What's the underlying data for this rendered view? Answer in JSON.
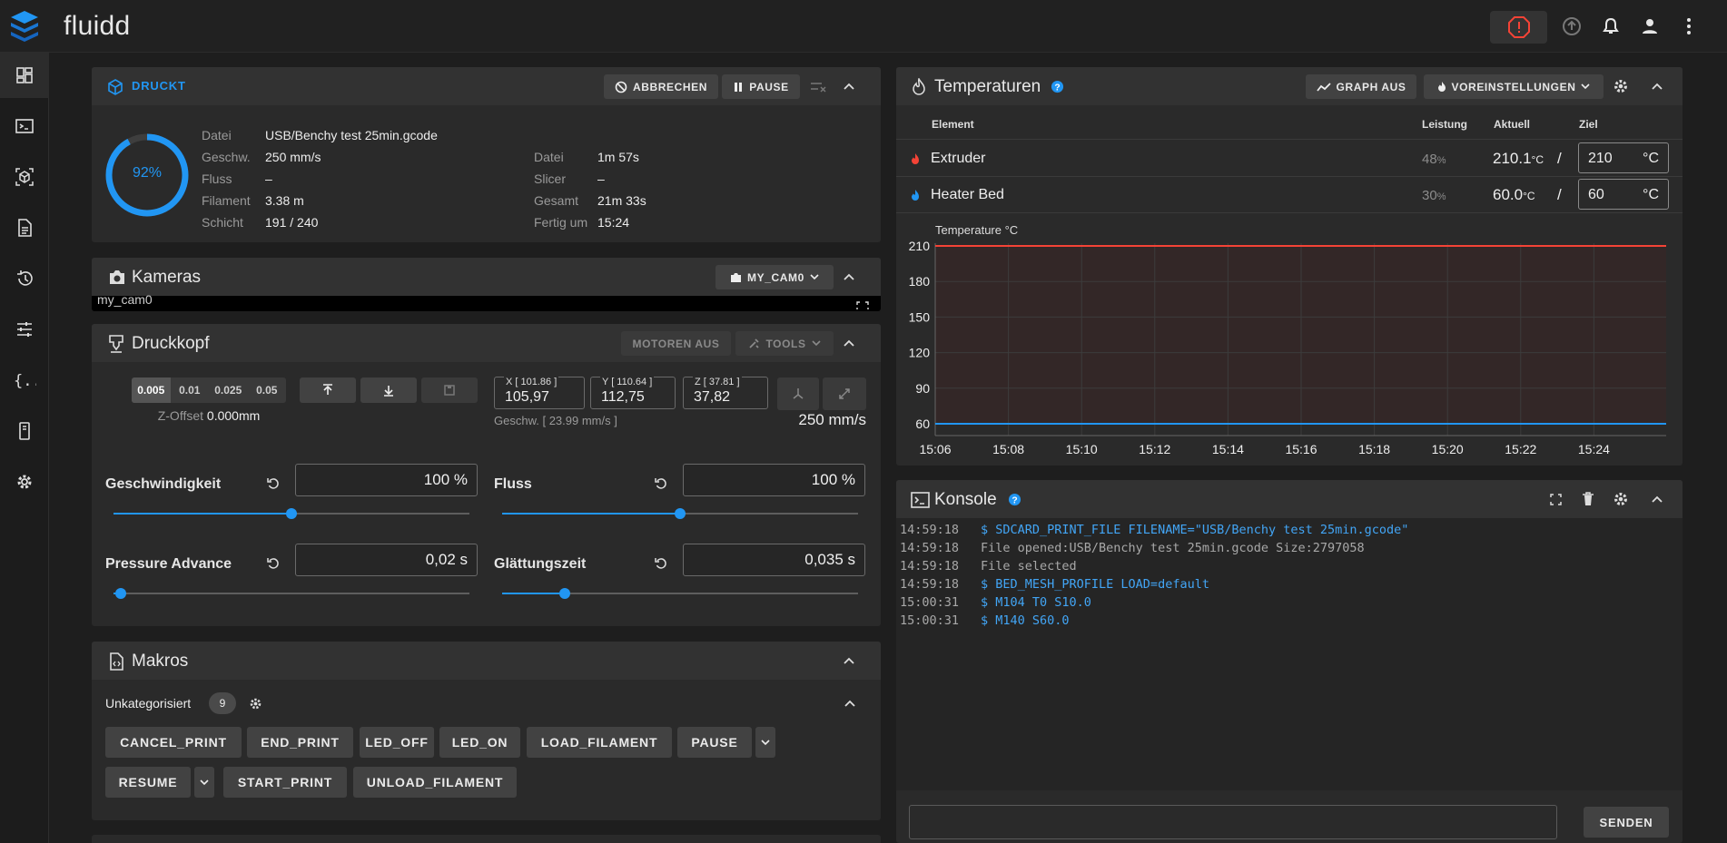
{
  "app": {
    "title": "fluidd"
  },
  "colors": {
    "accent": "#2196f3",
    "danger": "#f44336",
    "bg": "#1e1e1e",
    "card": "#2a2a2a"
  },
  "print_status": {
    "title": "DRUCKT",
    "cancel_label": "ABBRECHEN",
    "pause_label": "PAUSE",
    "progress": 0.92,
    "progress_label": "92%",
    "left": [
      {
        "label": "Datei",
        "value": "USB/Benchy test 25min.gcode"
      },
      {
        "label": "Geschw.",
        "value": "250 mm/s"
      },
      {
        "label": "Fluss",
        "value": "–"
      },
      {
        "label": "Filament",
        "value": "3.38 m"
      },
      {
        "label": "Schicht",
        "value": "191 / 240"
      }
    ],
    "right": [
      {
        "label": "Datei",
        "value": "1m 57s"
      },
      {
        "label": "Slicer",
        "value": "–"
      },
      {
        "label": "Gesamt",
        "value": "21m 33s"
      },
      {
        "label": "Fertig um",
        "value": "15:24"
      }
    ]
  },
  "cameras": {
    "title": "Kameras",
    "camera_select": "MY_CAM0",
    "camera_label": "my_cam0"
  },
  "toolhead": {
    "title": "Druckkopf",
    "motors_off_label": "MOTOREN AUS",
    "tools_label": "TOOLS",
    "z_steps": [
      "0.005",
      "0.01",
      "0.025",
      "0.05"
    ],
    "z_offset_label": "Z-Offset",
    "z_offset_value": "0.000mm",
    "x_label": "X [ 101.86 ]",
    "x_value": "105,97",
    "y_label": "Y [ 110.64 ]",
    "y_value": "112,75",
    "z_label": "Z [ 37.81 ]",
    "z_value": "37,82",
    "speed_note": "Geschw. [ 23.99 mm/s ]",
    "speed_value": "250 mm/s",
    "sliders": [
      {
        "label": "Geschwindigkeit",
        "value": "100 %",
        "level": 0.5
      },
      {
        "label": "Fluss",
        "value": "100 %",
        "level": 0.5
      },
      {
        "label": "Pressure Advance",
        "value": "0,02 s",
        "level": 0.02
      },
      {
        "label": "Glättungszeit",
        "value": "0,035 s",
        "level": 0.175
      }
    ]
  },
  "macros": {
    "title": "Makros",
    "group_label": "Unkategorisiert",
    "count": "9",
    "buttons_row1": [
      "CANCEL_PRINT",
      "END_PRINT",
      "LED_OFF",
      "LED_ON",
      "LOAD_FILAMENT",
      "PAUSE"
    ],
    "buttons_row2": [
      "RESUME",
      "START_PRINT",
      "UNLOAD_FILAMENT"
    ]
  },
  "temperatures": {
    "title": "Temperaturen",
    "graph_off_label": "GRAPH AUS",
    "presets_label": "VOREINSTELLUNGEN",
    "headers": {
      "element": "Element",
      "power": "Leistung",
      "actual": "Aktuell",
      "target": "Ziel"
    },
    "rows": [
      {
        "name": "Extruder",
        "power": "48",
        "power_unit": "%",
        "actual": "210.1",
        "unit": "°C",
        "target": "210",
        "target_unit": "°C",
        "color": "#f44336"
      },
      {
        "name": "Heater Bed",
        "power": "30",
        "power_unit": "%",
        "actual": "60.0",
        "unit": "°C",
        "target": "60",
        "target_unit": "°C",
        "color": "#2196f3"
      }
    ]
  },
  "chart_data": {
    "type": "line",
    "title": "",
    "ylabel": "Temperature °C",
    "x_ticks": [
      "15:06",
      "15:08",
      "15:10",
      "15:12",
      "15:14",
      "15:16",
      "15:18",
      "15:20",
      "15:22",
      "15:24"
    ],
    "y_ticks": [
      60,
      90,
      120,
      150,
      180,
      210
    ],
    "ylim": [
      50,
      220
    ],
    "grid": true,
    "series": [
      {
        "values": [
          210,
          210,
          210,
          210,
          210,
          210,
          210,
          210,
          210,
          210
        ],
        "color": "#f44336"
      },
      {
        "values": [
          60,
          60,
          60,
          60,
          60,
          60,
          60,
          60,
          60,
          60
        ],
        "color": "#2196f3"
      }
    ]
  },
  "console": {
    "title": "Konsole",
    "send_label": "SENDEN",
    "lines": [
      {
        "time": "14:59:18",
        "text": "$ SDCARD_PRINT_FILE FILENAME=\"USB/Benchy test 25min.gcode\"",
        "kind": "cmd"
      },
      {
        "time": "14:59:18",
        "text": "File opened:USB/Benchy test 25min.gcode Size:2797058",
        "kind": "resp"
      },
      {
        "time": "14:59:18",
        "text": "File selected",
        "kind": "resp"
      },
      {
        "time": "14:59:18",
        "text": "$ BED_MESH_PROFILE LOAD=default",
        "kind": "cmd"
      },
      {
        "time": "15:00:31",
        "text": "$ M104 T0 S10.0",
        "kind": "cmd"
      },
      {
        "time": "15:00:31",
        "text": "$ M140 S60.0",
        "kind": "cmd"
      }
    ]
  }
}
